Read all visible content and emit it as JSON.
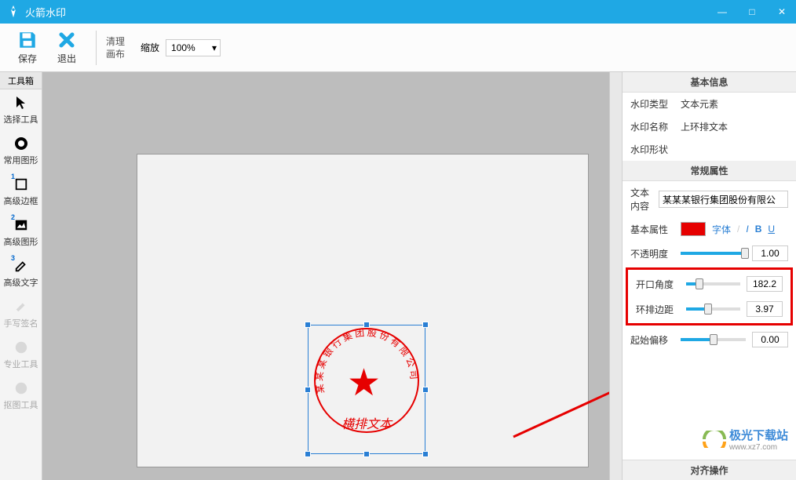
{
  "app": {
    "title": "火箭水印"
  },
  "win": {
    "min": "—",
    "max": "□",
    "close": "✕"
  },
  "toolbar": {
    "save": "保存",
    "exit": "退出",
    "clear_canvas_l1": "清理",
    "clear_canvas_l2": "画布",
    "zoom_label": "缩放",
    "zoom_value": "100%"
  },
  "sidebar": {
    "header": "工具箱",
    "items": [
      {
        "label": "选择工具",
        "icon": "cursor"
      },
      {
        "label": "常用图形",
        "icon": "circle"
      },
      {
        "label": "高级边框",
        "icon": "square",
        "sup": "1"
      },
      {
        "label": "高级图形",
        "icon": "image",
        "sup": "2"
      },
      {
        "label": "高级文字",
        "icon": "pencil",
        "sup": "3"
      },
      {
        "label": "手写签名",
        "icon": "sign",
        "disabled": true
      },
      {
        "label": "专业工具",
        "icon": "palette",
        "disabled": true
      },
      {
        "label": "抠图工具",
        "icon": "palette",
        "disabled": true
      }
    ]
  },
  "seal": {
    "arc_text": "某某某银行集团股份有限公司",
    "h_text": "横排文本"
  },
  "props": {
    "section_basic": "基本信息",
    "type_label": "水印类型",
    "type_value": "文本元素",
    "name_label": "水印名称",
    "name_value": "上环排文本",
    "shape_label": "水印形状",
    "section_normal": "常规属性",
    "text_label": "文本内容",
    "text_value": "某某某银行集团股份有限公",
    "baseattr_label": "基本属性",
    "font_link": "字体",
    "italic": "I",
    "bold": "B",
    "underline": "U",
    "opacity_label": "不透明度",
    "opacity_value": "1.00",
    "angle_label": "开口角度",
    "angle_value": "182.2",
    "margin_label": "环排边距",
    "margin_value": "3.97",
    "offset_label": "起始偏移",
    "offset_value": "0.00",
    "section_align": "对齐操作"
  },
  "watermark": {
    "brand": "极光下载站",
    "url": "www.xz7.com"
  }
}
